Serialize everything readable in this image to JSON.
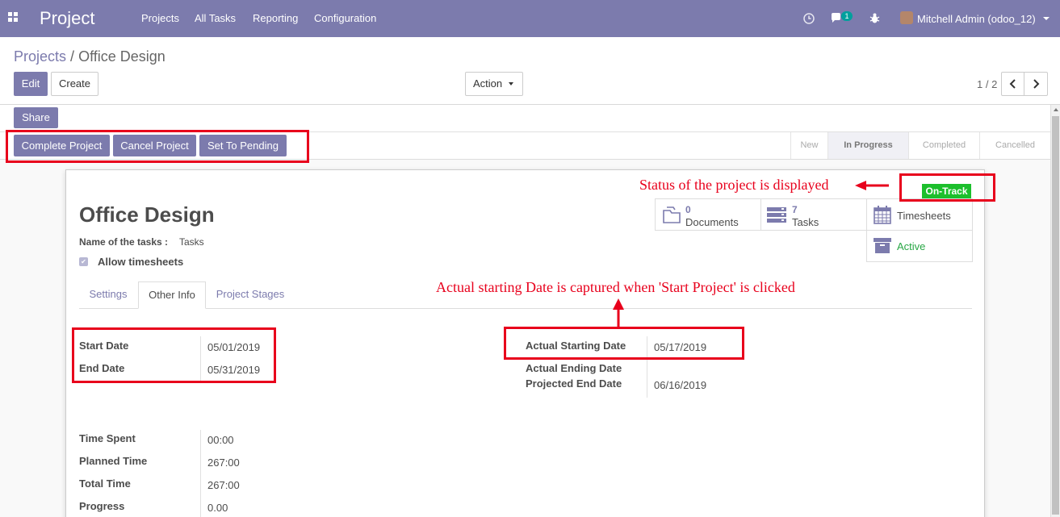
{
  "nav": {
    "brand": "Project",
    "menu": [
      "Projects",
      "All Tasks",
      "Reporting",
      "Configuration"
    ],
    "chat_badge": "1",
    "user": "Mitchell Admin (odoo_12)"
  },
  "breadcrumb": {
    "parent": "Projects",
    "separator": "/",
    "current": "Office Design"
  },
  "toolbar": {
    "edit": "Edit",
    "create": "Create",
    "action": "Action"
  },
  "pager": {
    "value": "1 / 2"
  },
  "share": "Share",
  "header_buttons": [
    "Complete Project",
    "Cancel Project",
    "Set To Pending"
  ],
  "stages": [
    "New",
    "In Progress",
    "Completed",
    "Cancelled"
  ],
  "status_badge": "On-Track",
  "smart_buttons": {
    "documents": {
      "count": "0",
      "label": "Documents"
    },
    "tasks": {
      "count": "7",
      "label": "Tasks"
    },
    "timesheets": {
      "label": "Timesheets"
    },
    "active": {
      "label": "Active"
    }
  },
  "record": {
    "title": "Office Design",
    "tasks_name_label": "Name of the tasks :",
    "tasks_name_value": "Tasks",
    "allow_timesheets": "Allow timesheets"
  },
  "tabs": [
    "Settings",
    "Other Info",
    "Project Stages"
  ],
  "fields": {
    "start_date_label": "Start Date",
    "start_date": "05/01/2019",
    "end_date_label": "End Date",
    "end_date": "05/31/2019",
    "actual_start_label": "Actual Starting Date",
    "actual_start": "05/17/2019",
    "actual_end_label": "Actual Ending Date",
    "projected_end_label": "Projected End Date",
    "projected_end": "06/16/2019",
    "time_spent_label": "Time Spent",
    "time_spent": "00:00",
    "planned_time_label": "Planned Time",
    "planned_time": "267:00",
    "total_time_label": "Total Time",
    "total_time": "267:00",
    "progress_label": "Progress",
    "progress": "0.00"
  },
  "annotations": {
    "status": "Status of the project is displayed",
    "actual_date": "Actual starting Date is captured when 'Start Project' is clicked"
  },
  "colors": {
    "brand": "#7c7bad",
    "annotation": "#e8001c",
    "on_track": "#1cbf2c",
    "active": "#28a745"
  }
}
